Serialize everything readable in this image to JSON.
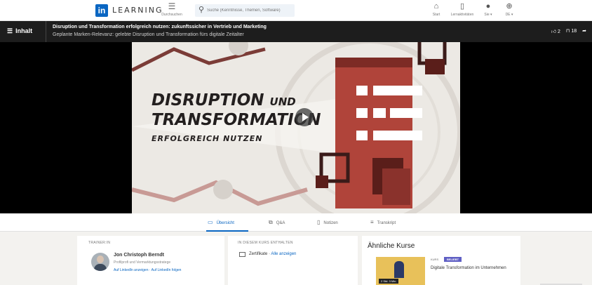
{
  "nav": {
    "logo_letters": "in",
    "logo_text": "LEARNING",
    "browse_label": "Durchsuchen",
    "search_placeholder": "Suche (Kenntnisse, Themen, Software)",
    "items": [
      {
        "icon": "home-icon",
        "label": "Start"
      },
      {
        "icon": "book-icon",
        "label": "Lernaktivitäten"
      },
      {
        "icon": "avatar-icon",
        "label": "Sie ▾"
      },
      {
        "icon": "globe-icon",
        "label": "DE ▾"
      }
    ]
  },
  "video_header": {
    "contents_label": "Inhalt",
    "title": "Disruption und Transformation erfolgreich nutzen: zukunftssicher in Vertrieb und Marketing",
    "subtitle": "Geplante Marken-Relevanz: gelebte Disruption und Transformation fürs digitale Zeitalter",
    "likes": "2",
    "saves": "18"
  },
  "poster": {
    "line1a": "DISRUPTION",
    "line1b": "UND",
    "line2": "TRANSFORMATION",
    "line3": "ERFOLGREICH NUTZEN",
    "colors": {
      "accent": "#b0443a",
      "dark": "#5a1e1a",
      "bg": "#ece9e4"
    }
  },
  "tabs": [
    {
      "label": "Übersicht",
      "icon": "overview-icon",
      "active": true
    },
    {
      "label": "Q&A",
      "icon": "qa-icon",
      "active": false
    },
    {
      "label": "Notizen",
      "icon": "notes-icon",
      "active": false
    },
    {
      "label": "Transkript",
      "icon": "transcript-icon",
      "active": false
    }
  ],
  "trainer": {
    "header": "TRAINER:IN",
    "name": "Jon Christoph Berndt",
    "role": "Profilprofi und Vermarktungsstratege",
    "links": "Auf LinkedIn anzeigen · Auf LinkedIn folgen"
  },
  "included": {
    "header": "IN DIESEM KURS ENTHALTEN",
    "item": "Zertifikate",
    "link": "Alle anzeigen"
  },
  "similar": {
    "header": "Ähnliche Kurse",
    "kind": "KURS",
    "badge": "BELIEBT",
    "title": "Digitale Transformation im Unternehmen",
    "duration": "2 Std. 3 Min."
  },
  "colors": {
    "brand": "#0a66c2",
    "video_bar": "#1d1d1d"
  }
}
